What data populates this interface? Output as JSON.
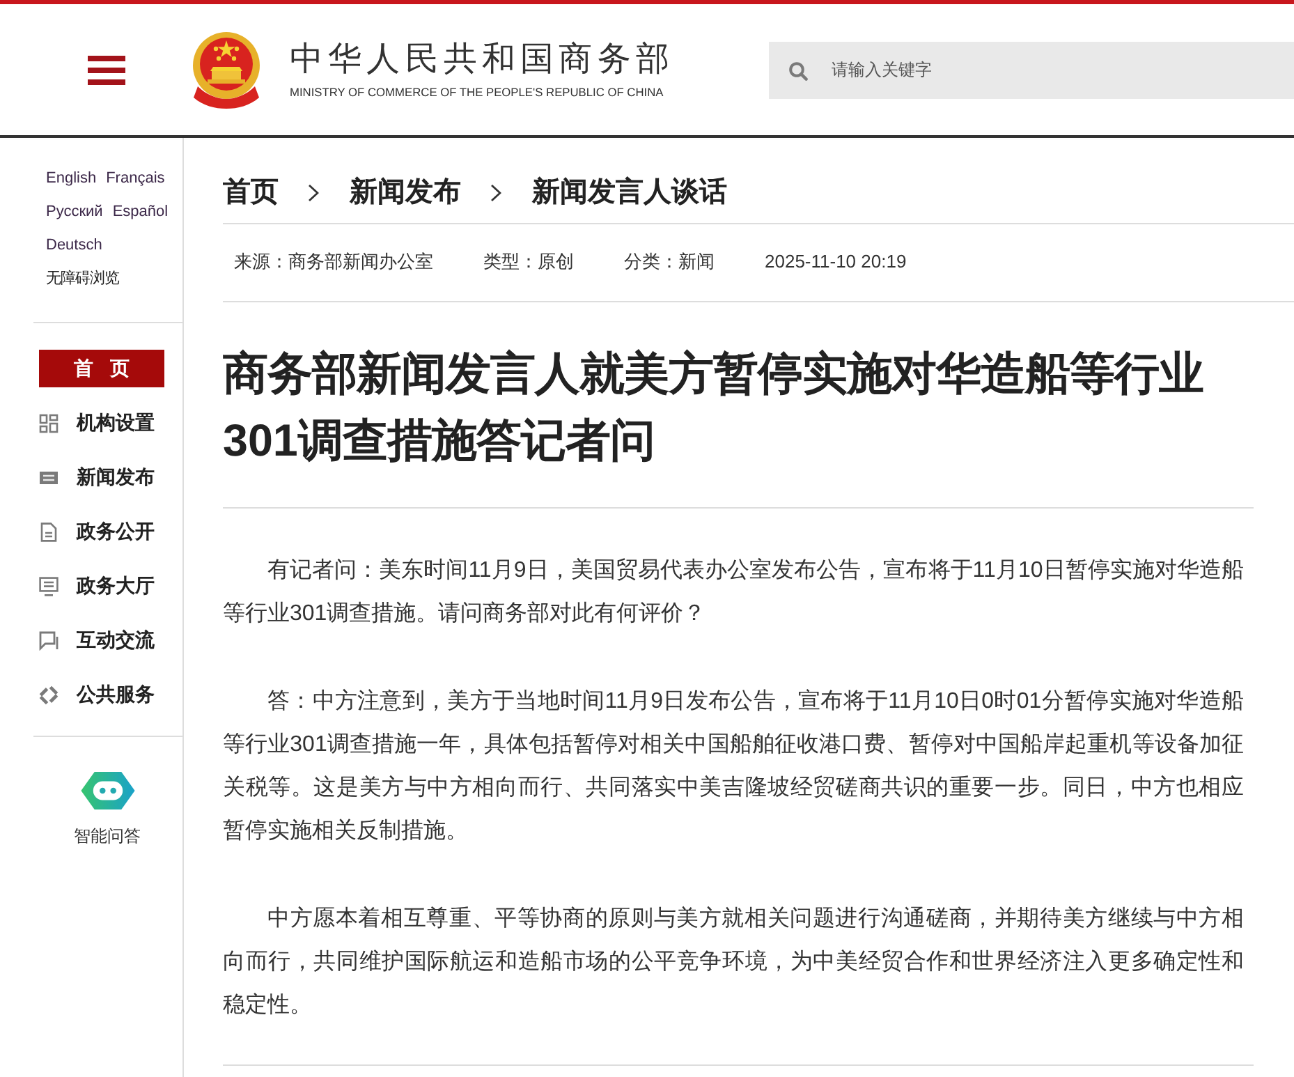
{
  "header": {
    "title": "中华人民共和国商务部",
    "subtitle": "MINISTRY OF COMMERCE OF THE PEOPLE'S REPUBLIC OF CHINA",
    "search": {
      "placeholder": "请输入关键字"
    }
  },
  "sidebar": {
    "language_rows": [
      [
        "English",
        "Français"
      ],
      [
        "Русский",
        "Español"
      ],
      [
        "Deutsch"
      ]
    ],
    "accessibility_link": "无障碍浏览",
    "nav": [
      {
        "label": "首 页",
        "selected": true
      },
      {
        "label": "机构设置",
        "selected": false
      },
      {
        "label": "新闻发布",
        "selected": false
      },
      {
        "label": "政务公开",
        "selected": false
      },
      {
        "label": "政务大厅",
        "selected": false
      },
      {
        "label": "互动交流",
        "selected": false
      },
      {
        "label": "公共服务",
        "selected": false
      }
    ],
    "assistant": {
      "label": "智能问答"
    }
  },
  "breadcrumb": [
    {
      "label": "首页"
    },
    {
      "label": "新闻发布"
    },
    {
      "label": "新闻发言人谈话"
    }
  ],
  "meta": {
    "source": "来源：商务部新闻办公室",
    "type": "类型：原创",
    "category": "分类：新闻",
    "date": "2025-11-10 20:19"
  },
  "article": {
    "title": "商务部新闻发言人就美方暂停实施对华造船等行业301调查措施答记者问",
    "paragraphs": [
      "有记者问：美东时间11月9日，美国贸易代表办公室发布公告，宣布将于11月10日暂停实施对华造船等行业301调查措施。请问商务部对此有何评价？",
      "答：中方注意到，美方于当地时间11月9日发布公告，宣布将于11月10日0时01分暂停实施对华造船等行业301调查措施一年，具体包括暂停对相关中国船舶征收港口费、暂停对中国船岸起重机等设备加征关税等。这是美方与中方相向而行、共同落实中美吉隆坡经贸磋商共识的重要一步。同日，中方也相应暂停实施相关反制措施。",
      "中方愿本着相互尊重、平等协商的原则与美方就相关问题进行沟通磋商，并期待美方继续与中方相向而行，共同维护国际航运和造船市场的公平竞争环境，为中美经贸合作和世界经济注入更多确定性和稳定性。"
    ]
  }
}
